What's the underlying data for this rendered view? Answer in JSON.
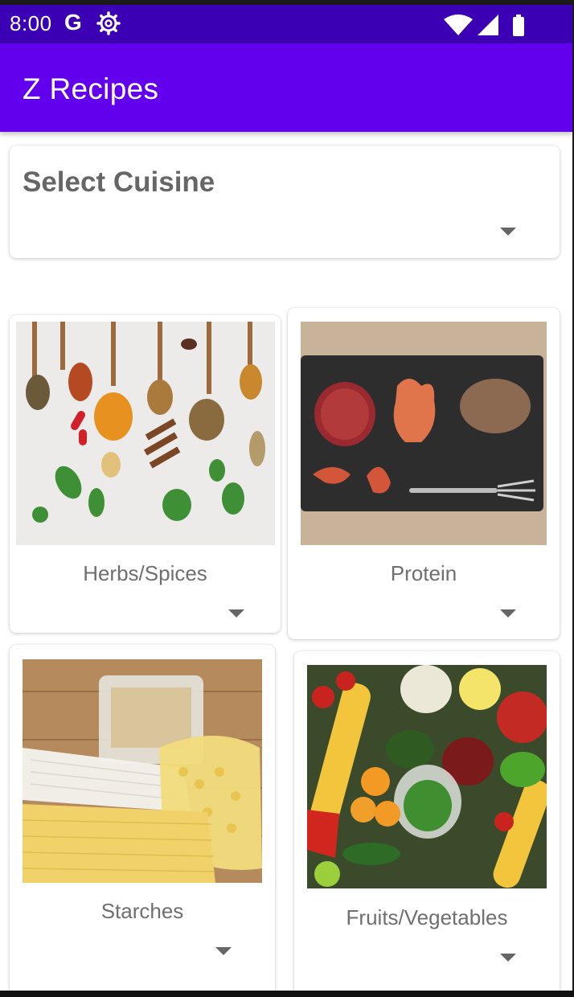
{
  "status_bar": {
    "time": "8:00",
    "g_label": "G",
    "icons": [
      "google-icon",
      "settings-icon",
      "wifi-icon",
      "signal-icon",
      "battery-icon"
    ]
  },
  "app_bar": {
    "title": "Z Recipes",
    "color": "#6200ee"
  },
  "cuisine": {
    "label": "Select Cuisine"
  },
  "categories": [
    {
      "label": "Herbs/Spices",
      "image": "spices-photo"
    },
    {
      "label": "Protein",
      "image": "protein-photo"
    },
    {
      "label": "Starches",
      "image": "starches-photo"
    },
    {
      "label": "Fruits/Vegetables",
      "image": "produce-photo"
    }
  ]
}
